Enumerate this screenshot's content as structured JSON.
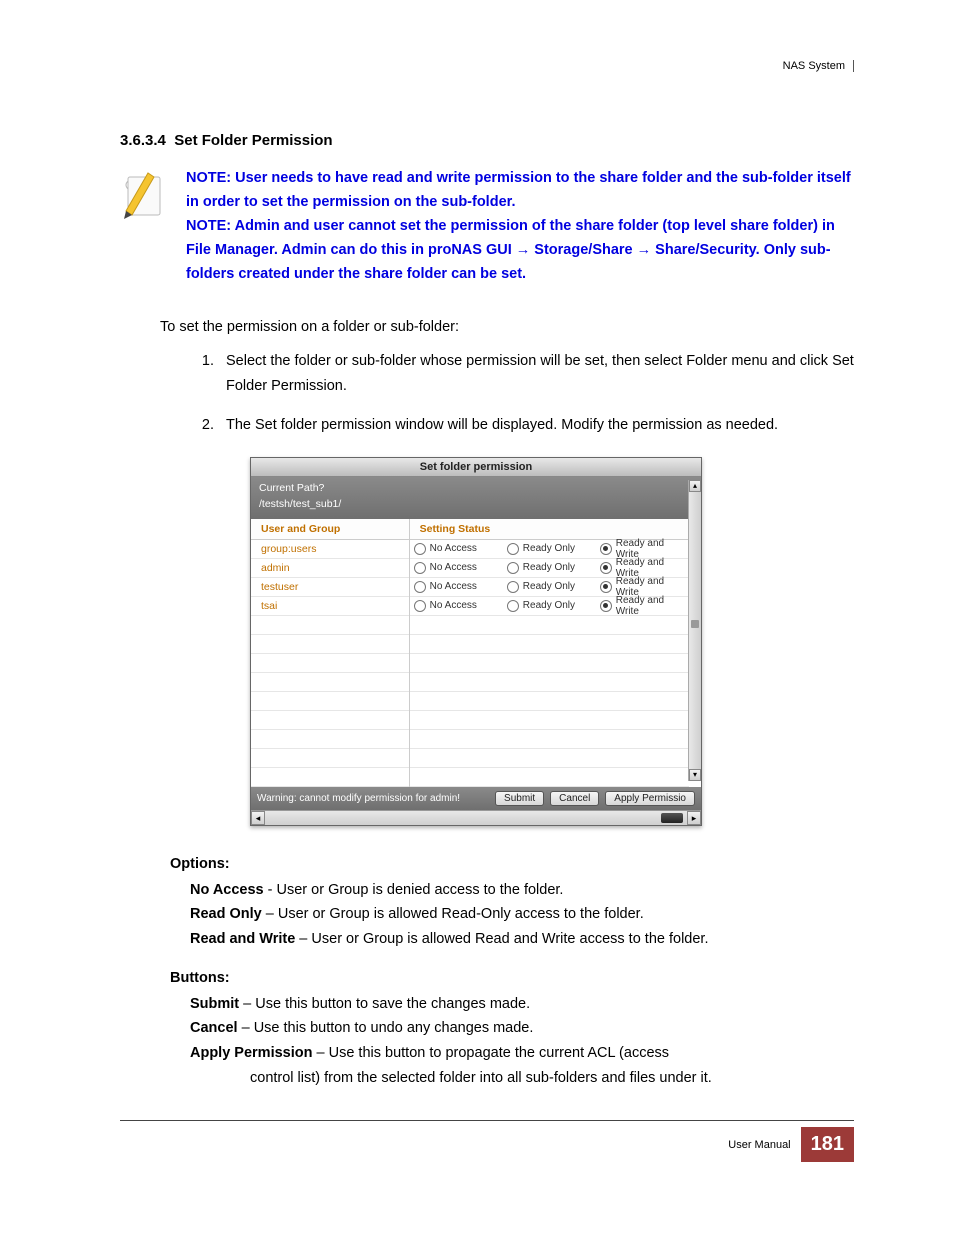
{
  "header": {
    "product": "NAS System"
  },
  "section": {
    "number": "3.6.3.4",
    "title": "Set Folder Permission"
  },
  "note": {
    "line1": "NOTE: User needs to have read and write permission to the share folder and the sub-folder itself in order to set the permission on the sub-folder.",
    "line2": "NOTE: Admin and user cannot set the permission of the share folder (top level share folder) in File Manager. Admin can do this in proNAS GUI → Storage/Share → Share/Security. Only sub-folders created under the share folder can be set."
  },
  "intro": "To set the permission on a folder or sub-folder:",
  "steps": [
    "Select the folder or sub-folder whose permission will be set, then select Folder menu and click Set Folder Permission.",
    "The Set folder permission window will be displayed. Modify the permission as needed."
  ],
  "dialog": {
    "title": "Set folder permission",
    "path_label": "Current Path?",
    "path_value": "/testsh/test_sub1/",
    "col_left": "User and Group",
    "col_right": "Setting Status",
    "radio_labels": {
      "na": "No Access",
      "ro": "Ready Only",
      "rw": "Ready and Write"
    },
    "rows": [
      {
        "name": "group:users",
        "sel": "rw"
      },
      {
        "name": "admin",
        "sel": "rw"
      },
      {
        "name": "testuser",
        "sel": "rw"
      },
      {
        "name": "tsai",
        "sel": "rw"
      }
    ],
    "warning": "Warning: cannot modify permission for admin!",
    "buttons": {
      "submit": "Submit",
      "cancel": "Cancel",
      "apply": "Apply Permissio"
    }
  },
  "options": {
    "heading": "Options:",
    "items": [
      {
        "term": "No Access",
        "sep": " - ",
        "desc": "User or Group is denied access to the folder."
      },
      {
        "term": "Read Only",
        "sep": " – ",
        "desc": "User or Group is allowed Read-Only access to the folder."
      },
      {
        "term": "Read and Write",
        "sep": " – ",
        "desc": "User or Group is allowed Read and Write access to the folder."
      }
    ]
  },
  "buttons_doc": {
    "heading": "Buttons:",
    "items": [
      {
        "term": "Submit",
        "sep": " – ",
        "desc": "Use this button to save the changes made."
      },
      {
        "term": "Cancel",
        "sep": " – ",
        "desc": "Use this button to undo any changes made."
      },
      {
        "term": "Apply Permission",
        "sep": " – ",
        "desc": "Use this button to propagate the current ACL (access",
        "cont": "control list) from the selected folder into all sub-folders and files under it."
      }
    ]
  },
  "footer": {
    "label": "User Manual",
    "page": "181"
  }
}
